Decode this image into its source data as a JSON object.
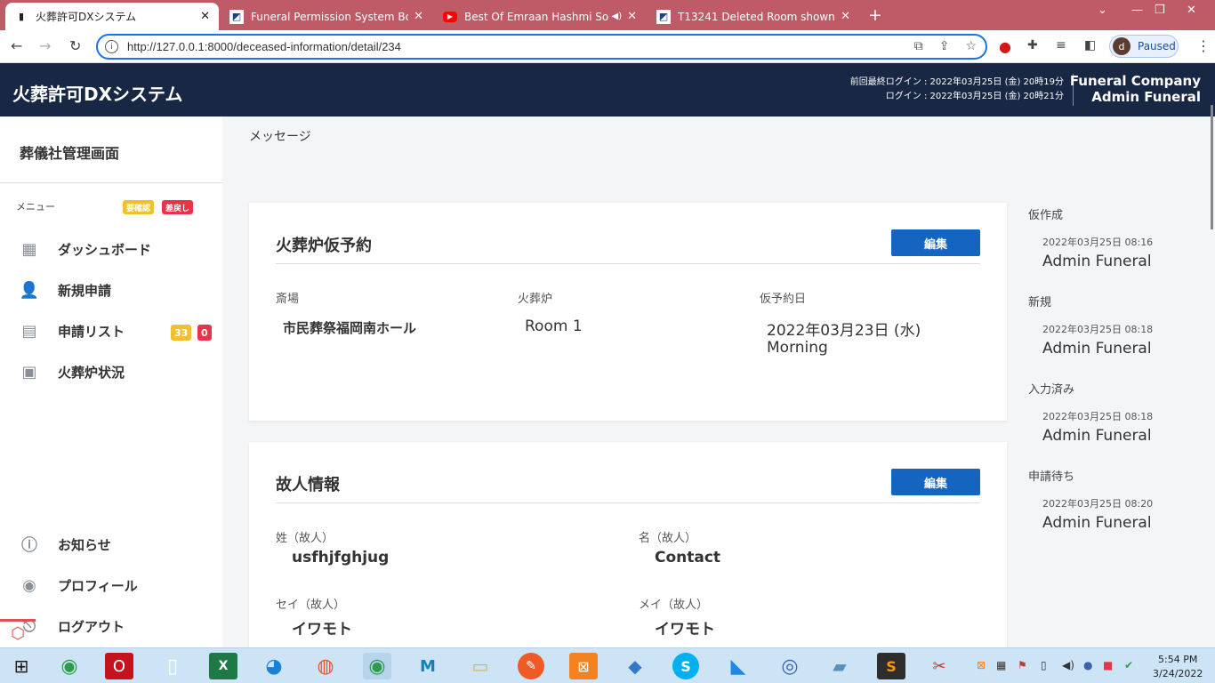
{
  "browser": {
    "tabs": [
      {
        "title": "火葬許可DXシステム",
        "icon": "tombstone-icon"
      },
      {
        "title": "Funeral Permission System Board",
        "icon": "jira-icon"
      },
      {
        "title": "Best Of Emraan Hashmi Song",
        "icon": "youtube-icon"
      },
      {
        "title": "T13241 Deleted Room shown in",
        "icon": "jira-icon"
      }
    ],
    "url": "http://127.0.0.1:8000/deceased-information/detail/234",
    "profile_initial": "d",
    "profile_status": "Paused"
  },
  "app": {
    "title": "火葬許可DXシステム",
    "last_login": "前回最終ログイン : 2022年03月25日 (金) 20時19分",
    "login": "ログイン : 2022年03月25日 (金) 20時21分",
    "company": "Funeral Company",
    "user": "Admin Funeral"
  },
  "sidebar": {
    "title": "葬儀社管理画面",
    "menu_label": "メニュー",
    "badge_confirm": "要確認",
    "badge_return": "差戻し",
    "items": [
      {
        "label": "ダッシュボード",
        "icon": "dashboard-icon"
      },
      {
        "label": "新規申請",
        "icon": "add-person-icon"
      },
      {
        "label": "申請リスト",
        "icon": "document-icon",
        "count_a": "33",
        "count_b": "0"
      },
      {
        "label": "火葬炉状況",
        "icon": "calendar-icon"
      }
    ],
    "bottom_items": [
      {
        "label": "お知らせ",
        "icon": "info-icon"
      },
      {
        "label": "プロフィール",
        "icon": "profile-icon"
      },
      {
        "label": "ログアウト",
        "icon": "logout-icon"
      }
    ]
  },
  "main": {
    "message_label": "メッセージ",
    "reservation": {
      "title": "火葬炉仮予約",
      "edit": "編集",
      "hall_label": "斎場",
      "hall": "市民葬祭福岡南ホール",
      "furnace_label": "火葬炉",
      "furnace": "Room 1",
      "date_label": "仮予約日",
      "date": "2022年03月23日 (水)",
      "slot": "Morning"
    },
    "deceased": {
      "title": "故人情報",
      "edit": "編集",
      "last_name_label": "姓（故人）",
      "last_name": "usfhjfghjug",
      "first_name_label": "名（故人）",
      "first_name": "Contact",
      "last_kana_label": "セイ（故人）",
      "last_kana": "イワモト",
      "first_kana_label": "メイ（故人）",
      "first_kana": "イワモト"
    }
  },
  "timeline": [
    {
      "status": "仮作成",
      "datetime": "2022年03月25日 08:16",
      "user": "Admin Funeral"
    },
    {
      "status": "新規",
      "datetime": "2022年03月25日 08:18",
      "user": "Admin Funeral"
    },
    {
      "status": "入力済み",
      "datetime": "2022年03月25日 08:18",
      "user": "Admin Funeral"
    },
    {
      "status": "申請待ち",
      "datetime": "2022年03月25日 08:20",
      "user": "Admin Funeral"
    }
  ],
  "taskbar": {
    "time": "5:54 PM",
    "date": "3/24/2022"
  },
  "colors": {
    "header": "#172744",
    "tabbar": "#bf5b66",
    "edit_button": "#1565c0",
    "badge_yellow": "#f0c030",
    "badge_red": "#e8334a"
  }
}
